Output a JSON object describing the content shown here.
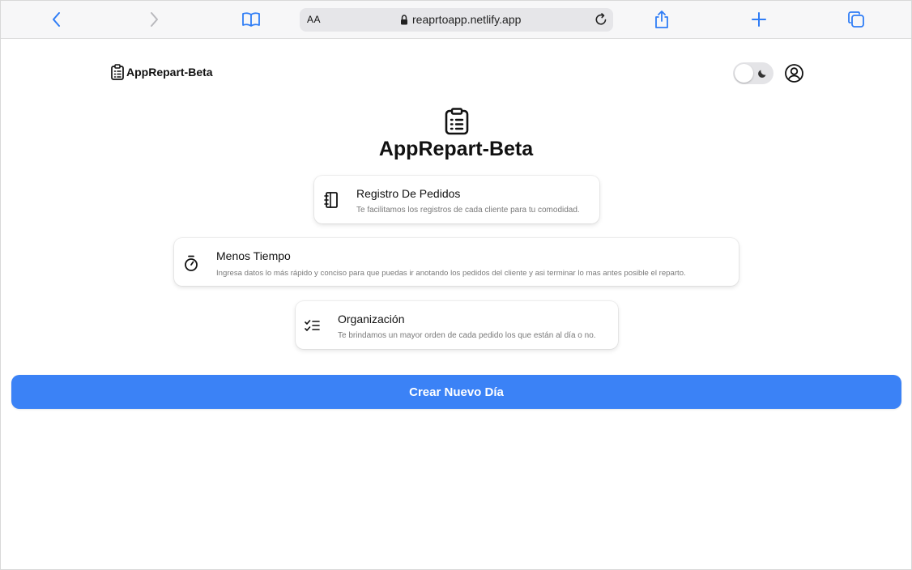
{
  "browser": {
    "aa_label": "AA",
    "url": "reaprtoapp.netlify.app",
    "accent_color": "#2f7df6"
  },
  "header": {
    "brand": "AppRepart-Beta",
    "theme_toggle_state": "light"
  },
  "hero": {
    "title": "AppRepart-Beta"
  },
  "features": [
    {
      "icon": "notebook-icon",
      "title": "Registro De Pedidos",
      "description": "Te facilitamos los registros de cada cliente para tu comodidad."
    },
    {
      "icon": "stopwatch-icon",
      "title": "Menos Tiempo",
      "description": "Ingresa datos lo más rápido y conciso para que puedas ir anotando los pedidos del cliente y asi terminar lo mas antes posible el reparto."
    },
    {
      "icon": "checklist-icon",
      "title": "Organización",
      "description": "Te brindamos un mayor orden de cada pedido los que están al día o no."
    }
  ],
  "cta": {
    "label": "Crear Nuevo Día",
    "color": "#3b82f6"
  }
}
